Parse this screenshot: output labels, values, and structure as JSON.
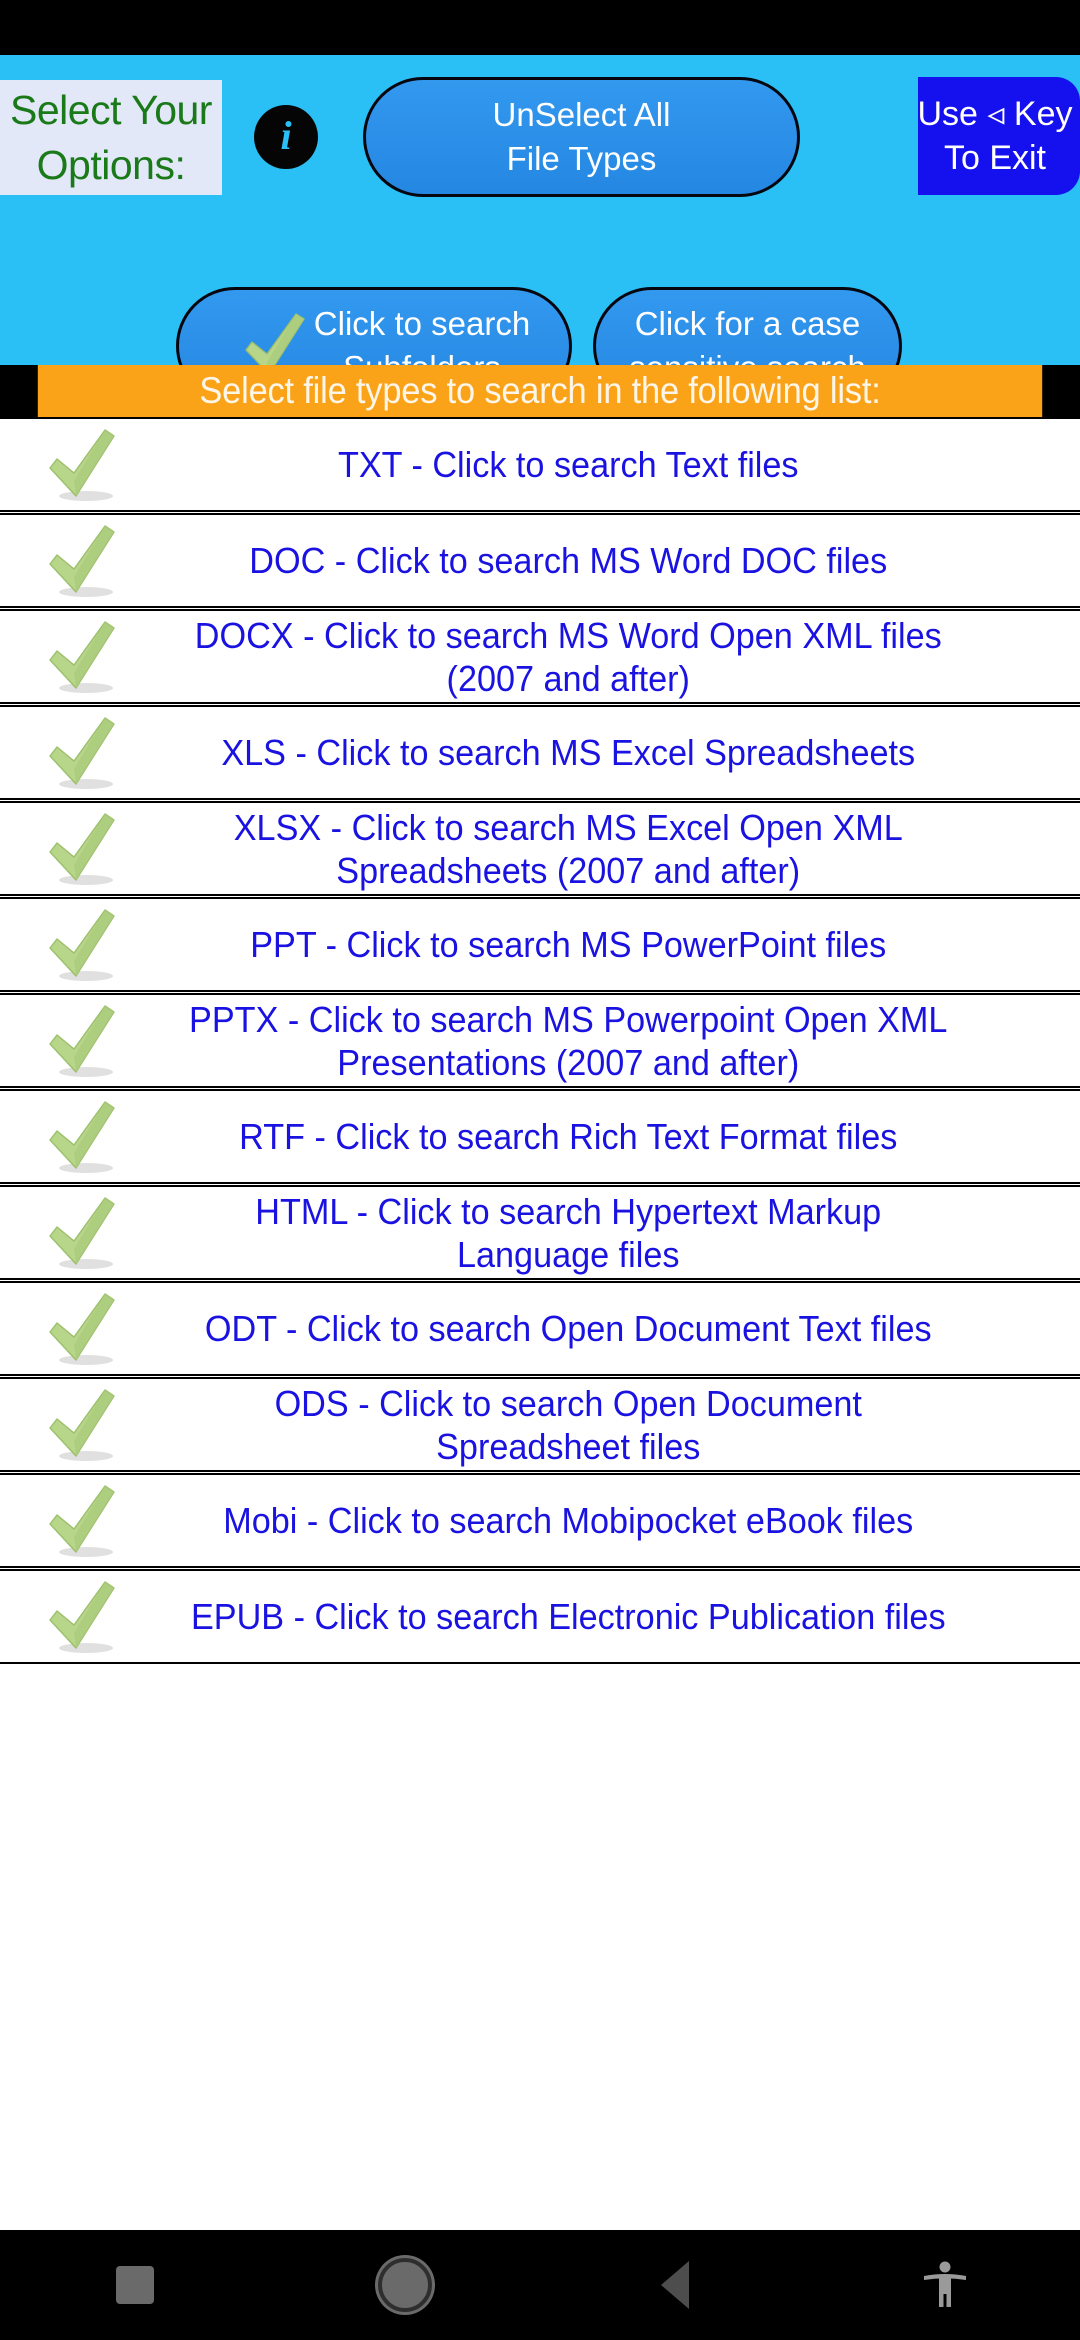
{
  "header": {
    "options_label_line1": "Select Your",
    "options_label_line2": "Options:",
    "info_icon_glyph": "i",
    "unselect_all_line1": "UnSelect All",
    "unselect_all_line2": "File Types",
    "exit_line1": "Use ◃ Key",
    "exit_line2": "To Exit",
    "subfolders_line1": "Click to search",
    "subfolders_line2": "Subfolders",
    "case_sensitive_line1": "Click for a case",
    "case_sensitive_line2": "sensitive search",
    "colors": {
      "header_background": "#2bc0f5",
      "pill_blue": "#2c8fe8",
      "exit_blue": "#1411ee",
      "options_text_green": "#1a7a1a",
      "options_background": "#e2e8f7"
    }
  },
  "banner": {
    "text": "Select file types to search in the following list:",
    "background": "#fba318",
    "text_color": "#fdf6e8"
  },
  "list": {
    "check_icon": "check-mark-icon",
    "text_color": "#1a12e0",
    "items": [
      {
        "label": "TXT - Click to search Text files",
        "checked": true
      },
      {
        "label": "DOC - Click to search MS Word DOC files",
        "checked": true
      },
      {
        "label": "DOCX - Click to search MS Word Open XML files (2007 and after)",
        "checked": true
      },
      {
        "label": "XLS - Click to search MS Excel Spreadsheets",
        "checked": true
      },
      {
        "label": "XLSX - Click to search MS Excel Open XML Spreadsheets (2007 and after)",
        "checked": true
      },
      {
        "label": "PPT - Click to search MS PowerPoint files",
        "checked": true
      },
      {
        "label": "PPTX - Click to search MS Powerpoint Open XML Presentations (2007 and after)",
        "checked": true
      },
      {
        "label": "RTF - Click to search Rich Text Format files",
        "checked": true
      },
      {
        "label": "HTML - Click to search Hypertext Markup Language files",
        "checked": true
      },
      {
        "label": "ODT - Click to search Open Document Text files",
        "checked": true
      },
      {
        "label": "ODS - Click to search Open Document Spreadsheet files",
        "checked": true
      },
      {
        "label": "Mobi - Click to search Mobipocket eBook files",
        "checked": true
      },
      {
        "label": "EPUB - Click to search Electronic Publication files",
        "checked": true
      }
    ]
  },
  "nav_bar": {
    "recents": "recents-icon",
    "home": "home-icon",
    "back": "back-icon",
    "accessibility": "accessibility-icon"
  }
}
